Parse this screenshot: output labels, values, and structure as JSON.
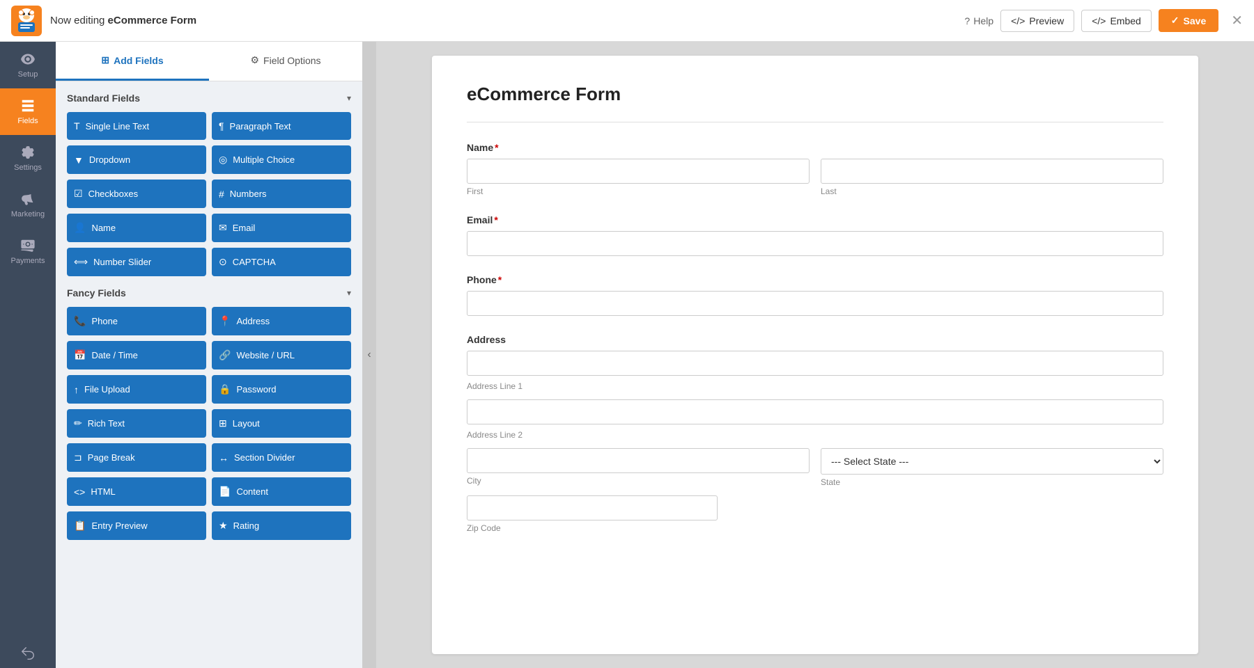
{
  "topbar": {
    "logo_alt": "WPForms Bear Logo",
    "editing_prefix": "Now editing ",
    "form_name": "eCommerce Form",
    "help_label": "Help",
    "preview_label": "Preview",
    "embed_label": "Embed",
    "save_label": "Save"
  },
  "nav": {
    "items": [
      {
        "id": "setup",
        "label": "Setup",
        "icon": "gear"
      },
      {
        "id": "fields",
        "label": "Fields",
        "icon": "fields",
        "active": true
      },
      {
        "id": "settings",
        "label": "Settings",
        "icon": "settings"
      },
      {
        "id": "marketing",
        "label": "Marketing",
        "icon": "marketing"
      },
      {
        "id": "payments",
        "label": "Payments",
        "icon": "payments"
      }
    ],
    "bottom": {
      "id": "undo",
      "label": "",
      "icon": "undo"
    }
  },
  "panel": {
    "tab_add_fields": "Add Fields",
    "tab_field_options": "Field Options",
    "sections": [
      {
        "id": "standard",
        "title": "Standard Fields",
        "expanded": true,
        "fields": [
          {
            "id": "single-line-text",
            "label": "Single Line Text",
            "icon": "T"
          },
          {
            "id": "paragraph-text",
            "label": "Paragraph Text",
            "icon": "¶"
          },
          {
            "id": "dropdown",
            "label": "Dropdown",
            "icon": "▼"
          },
          {
            "id": "multiple-choice",
            "label": "Multiple Choice",
            "icon": "◎"
          },
          {
            "id": "checkboxes",
            "label": "Checkboxes",
            "icon": "☑"
          },
          {
            "id": "numbers",
            "label": "Numbers",
            "icon": "#"
          },
          {
            "id": "name",
            "label": "Name",
            "icon": "👤"
          },
          {
            "id": "email",
            "label": "Email",
            "icon": "✉"
          },
          {
            "id": "number-slider",
            "label": "Number Slider",
            "icon": "⟺"
          },
          {
            "id": "captcha",
            "label": "CAPTCHA",
            "icon": "⊙"
          }
        ]
      },
      {
        "id": "fancy",
        "title": "Fancy Fields",
        "expanded": true,
        "fields": [
          {
            "id": "phone",
            "label": "Phone",
            "icon": "📞"
          },
          {
            "id": "address",
            "label": "Address",
            "icon": "📍"
          },
          {
            "id": "date-time",
            "label": "Date / Time",
            "icon": "📅"
          },
          {
            "id": "website-url",
            "label": "Website / URL",
            "icon": "🔗"
          },
          {
            "id": "file-upload",
            "label": "File Upload",
            "icon": "↑"
          },
          {
            "id": "password",
            "label": "Password",
            "icon": "🔒"
          },
          {
            "id": "rich-text",
            "label": "Rich Text",
            "icon": "✏"
          },
          {
            "id": "layout",
            "label": "Layout",
            "icon": "⊞"
          },
          {
            "id": "page-break",
            "label": "Page Break",
            "icon": "⊐"
          },
          {
            "id": "section-divider",
            "label": "Section Divider",
            "icon": "↔"
          },
          {
            "id": "html",
            "label": "HTML",
            "icon": "<>"
          },
          {
            "id": "content",
            "label": "Content",
            "icon": "📄"
          },
          {
            "id": "entry-preview",
            "label": "Entry Preview",
            "icon": "📋"
          },
          {
            "id": "rating",
            "label": "Rating",
            "icon": "★"
          }
        ]
      }
    ]
  },
  "form": {
    "title": "eCommerce Form",
    "fields": [
      {
        "id": "name-field",
        "label": "Name",
        "required": true,
        "type": "name",
        "subfields": [
          {
            "placeholder": "",
            "sublabel": "First"
          },
          {
            "placeholder": "",
            "sublabel": "Last"
          }
        ]
      },
      {
        "id": "email-field",
        "label": "Email",
        "required": true,
        "type": "email"
      },
      {
        "id": "phone-field",
        "label": "Phone",
        "required": true,
        "type": "phone"
      },
      {
        "id": "address-field",
        "label": "Address",
        "required": false,
        "type": "address",
        "subfields": [
          {
            "placeholder": "",
            "sublabel": "Address Line 1"
          },
          {
            "placeholder": "",
            "sublabel": "Address Line 2"
          },
          {
            "placeholder": "",
            "sublabel": "City"
          },
          {
            "placeholder": "--- Select State ---",
            "sublabel": "State",
            "type": "select"
          },
          {
            "placeholder": "",
            "sublabel": "Zip Code"
          }
        ]
      }
    ]
  }
}
